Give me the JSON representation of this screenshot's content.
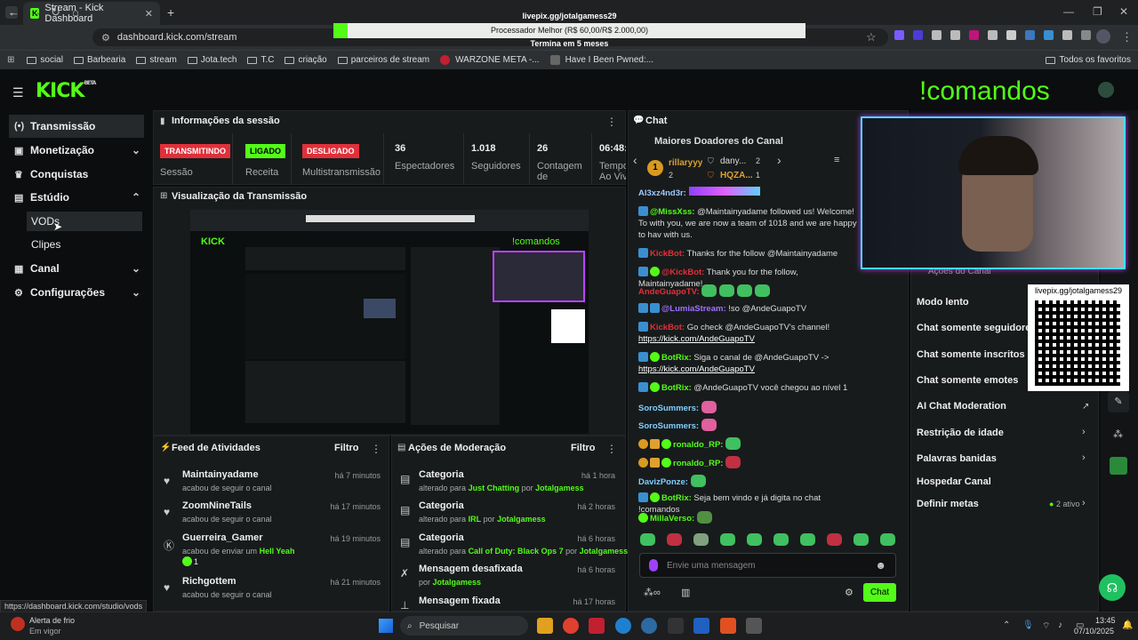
{
  "browser": {
    "tab_title": "Stream - Kick Dashboard",
    "url": "dashboard.kick.com/stream",
    "bookmarks": [
      "social",
      "Barbearia",
      "stream",
      "Jota.tech",
      "T.C",
      "criação",
      "parceiros de stream",
      "WARZONE META -...",
      "Have I Been Pwned:..."
    ],
    "all_bookmarks": "Todos os favoritos",
    "status_url": "https://dashboard.kick.com/studio/vods"
  },
  "overlay": {
    "livepix_url": "livepix.gg/jotalgamess29",
    "goal_text": "Processador Melhor (R$ 60,00/R$ 2.000,00)",
    "goal_progress": 0.03,
    "goal_ends": "Termina em 5 meses",
    "comandos": "!comandos",
    "qr_url": "livepix.gg/jotalgamess29"
  },
  "sidebar": {
    "items": [
      {
        "label": "Transmissão",
        "icon": "broadcast-icon"
      },
      {
        "label": "Monetização",
        "icon": "wallet-icon"
      },
      {
        "label": "Conquistas",
        "icon": "trophy-icon"
      },
      {
        "label": "Estúdio",
        "icon": "studio-icon"
      },
      {
        "label": "Canal",
        "icon": "channel-icon"
      },
      {
        "label": "Configurações",
        "icon": "gear-icon"
      }
    ],
    "sub_items": [
      "VODs",
      "Clipes"
    ]
  },
  "session": {
    "title": "Informações da sessão",
    "stats": [
      {
        "badge": "TRANSMITINDO",
        "label": "Sessão"
      },
      {
        "badge": "LIGADO",
        "label": "Receita"
      },
      {
        "badge": "DESLIGADO",
        "label": "Multistransmissão"
      },
      {
        "value": "36",
        "label": "Espectadores"
      },
      {
        "value": "1.018",
        "label": "Seguidores"
      },
      {
        "value": "26",
        "label": "Contagem de"
      },
      {
        "value": "06:48:",
        "label": "Tempo Ao Viv"
      }
    ]
  },
  "preview": {
    "title": "Visualização da Transmissão"
  },
  "feed": {
    "title": "Feed de Atividades",
    "filter": "Filtro",
    "rows": [
      {
        "name": "Maintainyadame",
        "desc": "acabou de seguir o canal",
        "time": "há 7 minutos"
      },
      {
        "name": "ZoomNineTails",
        "desc": "acabou de seguir o canal",
        "time": "há 17 minutos"
      },
      {
        "name": "Guerreira_Gamer",
        "desc": "acabou de enviar um",
        "highlight": "Hell Yeah",
        "count": "1",
        "time": "há 19 minutos"
      },
      {
        "name": "Richgottem",
        "desc": "acabou de seguir o canal",
        "time": "há 21 minutos"
      }
    ]
  },
  "moderation": {
    "title": "Ações de Moderação",
    "filter": "Filtro",
    "rows": [
      {
        "name": "Categoria",
        "pre": "alterado para",
        "value": "Just Chatting",
        "by": "por",
        "user": "Jotalgamess",
        "time": "há 1 hora"
      },
      {
        "name": "Categoria",
        "pre": "alterado para",
        "value": "IRL",
        "by": "por",
        "user": "Jotalgamess",
        "time": "há 2 horas"
      },
      {
        "name": "Categoria",
        "pre": "alterado para",
        "value": "Call of Duty: Black Ops 7",
        "by": "por",
        "user": "Jotalgamess",
        "time": "há 6 horas"
      },
      {
        "name": "Mensagem desafixada",
        "pre": "por",
        "value": "Jotalgamess",
        "by": "",
        "user": "",
        "time": "há 6 horas"
      },
      {
        "name": "Mensagem fixada",
        "pre": "",
        "value": "",
        "by": "",
        "user": "",
        "time": "há 17 horas"
      }
    ]
  },
  "chat": {
    "title": "Chat",
    "donors_title": "Maiores Doadores do Canal",
    "donors": [
      {
        "rank": "1",
        "name": "rillaryyy",
        "count": "2"
      },
      {
        "rank": "",
        "name": "dany...",
        "count": "2"
      },
      {
        "rank": "",
        "name": "HQZA...",
        "count": "1"
      }
    ],
    "messages": [
      {
        "user": "Al3xz4nd3r:",
        "text": "",
        "color": "#9ec8ff"
      },
      {
        "user": "@MissXss:",
        "text": "@Maintainyadame followed us! Welcome! To with you, we are now a team of 1018 and we are happy to hav with us.",
        "color": "#53fc18"
      },
      {
        "user": "KickBot:",
        "text": "Thanks for the follow @Maintainyadame",
        "color": "#e0303a"
      },
      {
        "user": "@KickBot:",
        "text": "Thank you for the follow, Maintainyadame!",
        "color": "#e0303a"
      },
      {
        "user": "AndeGuapoTV:",
        "text": "",
        "color": "#e0303a"
      },
      {
        "user": "@LumiaStream:",
        "text": "!so @AndeGuapoTV",
        "color": "#a070ff"
      },
      {
        "user": "KickBot:",
        "text": "Go check @AndeGuapoTV's channel!",
        "link": "https://kick.com/AndeGuapoTV",
        "color": "#e0303a"
      },
      {
        "user": "BotRix:",
        "text": "Siga o canal de @AndeGuapoTV ->",
        "link": "https://kick.com/AndeGuapoTV",
        "color": "#53fc18"
      },
      {
        "user": "BotRix:",
        "text": "@AndeGuapoTV você chegou ao nível 1",
        "color": "#53fc18"
      },
      {
        "user": "SoroSummers:",
        "text": "",
        "color": "#7fd0ff"
      },
      {
        "user": "SoroSummers:",
        "text": "",
        "color": "#7fd0ff"
      },
      {
        "user": "ronaldo_RP:",
        "text": "",
        "color": "#53fc18"
      },
      {
        "user": "ronaldo_RP:",
        "text": "",
        "color": "#53fc18"
      },
      {
        "user": "DavizPonze:",
        "text": "",
        "color": "#7fd0ff"
      },
      {
        "user": "BotRix:",
        "text": "Seja bem vindo e já digita no chat !comandos",
        "color": "#53fc18"
      },
      {
        "user": "MillaVerso:",
        "text": "",
        "color": "#53fc18"
      }
    ],
    "input_placeholder": "Envie uma mensagem",
    "send": "Chat"
  },
  "options": {
    "title": "Ações do Canal",
    "items": [
      {
        "label": "Modo lento"
      },
      {
        "label": "Chat somente seguidores"
      },
      {
        "label": "Chat somente inscritos"
      },
      {
        "label": "Chat somente emotes"
      },
      {
        "label": "AI Chat Moderation"
      },
      {
        "label": "Restrição de idade"
      },
      {
        "label": "Palavras banidas"
      },
      {
        "label": "Hospedar Canal"
      },
      {
        "label": "Definir metas",
        "extra": "2 ativo"
      }
    ]
  },
  "taskbar": {
    "weather": "Alerta de frio",
    "weather_sub": "Em vigor",
    "search": "Pesquisar",
    "time": "13:45",
    "date": "07/10/2025"
  }
}
